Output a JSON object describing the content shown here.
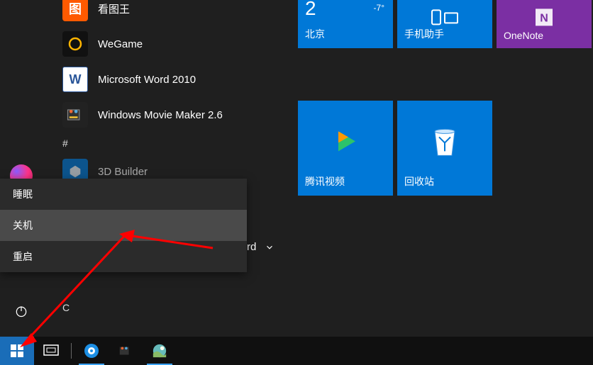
{
  "apps": [
    {
      "label": "看图王",
      "icon_bg": "#ff5a00",
      "icon_text": "图"
    },
    {
      "label": "WeGame",
      "icon_bg": "#111",
      "icon_ring": "#ffb400"
    },
    {
      "label": "Microsoft Word 2010",
      "icon_bg": "#2a5699",
      "icon_text": "W"
    },
    {
      "label": "Windows Movie Maker 2.6",
      "icon_bg": "#222",
      "icon_movie": true
    }
  ],
  "letter_header": "#",
  "hidden_app_1": "3D Builder",
  "hidden_app_2_suffix": "rd",
  "letter_c": "C",
  "power_menu": {
    "sleep": "睡眠",
    "shutdown": "关机",
    "restart": "重启"
  },
  "tiles": {
    "weather": {
      "city": "北京",
      "temp": "2",
      "low": "-7°"
    },
    "phone": {
      "label": "手机助手"
    },
    "onenote": {
      "label": "OneNote"
    },
    "video": {
      "label": "腾讯视频"
    },
    "recycle": {
      "label": "回收站"
    }
  }
}
